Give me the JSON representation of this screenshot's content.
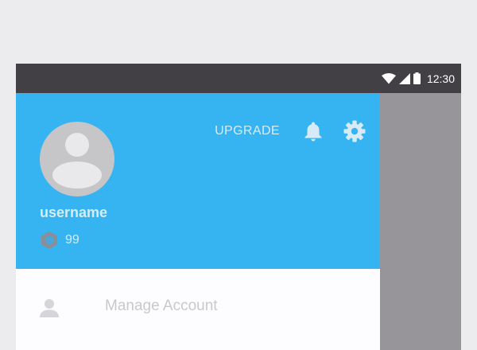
{
  "status_bar": {
    "time": "12:30",
    "icons": [
      "wifi-icon",
      "signal-icon",
      "battery-icon"
    ],
    "background": "#434045"
  },
  "drawer": {
    "header": {
      "background": "#36b4f2",
      "username": "username",
      "coin_icon": "hexagon-coin-icon",
      "coin_count": "99",
      "upgrade_label": "UPGRADE",
      "notification_icon": "bell-icon",
      "settings_icon": "gear-icon"
    },
    "menu": [
      {
        "label": "Manage Account",
        "icon": "person-icon"
      }
    ]
  },
  "scrim": {
    "color": "#97959a"
  }
}
